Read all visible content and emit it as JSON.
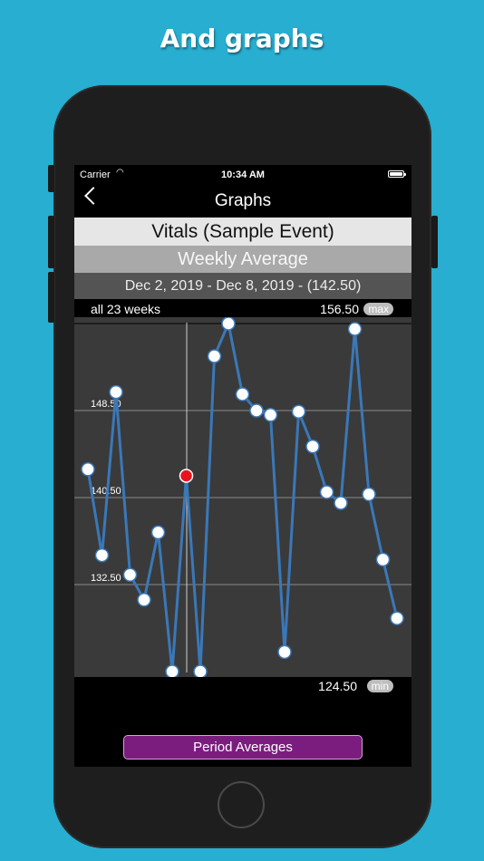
{
  "headline": "And graphs",
  "status_bar": {
    "carrier": "Carrier",
    "time": "10:34 AM"
  },
  "nav": {
    "title": "Graphs"
  },
  "event_title": "Vitals (Sample Event)",
  "mode_label": "Weekly Average",
  "selected_range": "Dec 2, 2019 - Dec 8, 2019 - (142.50)",
  "range_label": "all 23 weeks",
  "max_value": "156.50",
  "max_badge": "max",
  "min_value": "124.50",
  "min_badge": "min",
  "button_label": "Period Averages",
  "colors": {
    "line": "#3a78b8",
    "point": "#ffffff",
    "selected_point": "#e8141d",
    "button": "#7a1d7e",
    "plot_bg": "#3a3a3a"
  },
  "chart_data": {
    "type": "line",
    "ylim": [
      124.5,
      156.5
    ],
    "grid": true,
    "y_tick_labels": [
      "148.50",
      "140.50",
      "132.50"
    ],
    "x": [
      1,
      2,
      3,
      4,
      5,
      6,
      7,
      8,
      9,
      10,
      11,
      12,
      13,
      14,
      15,
      16,
      17,
      18,
      19,
      20,
      21,
      22,
      23
    ],
    "series": [
      {
        "values": [
          143.1,
          135.2,
          150.2,
          133.4,
          131.1,
          137.3,
          124.5,
          142.5,
          124.5,
          153.5,
          156.5,
          150.0,
          148.5,
          148.1,
          126.3,
          148.4,
          145.2,
          141.0,
          140.0,
          156.0,
          140.8,
          134.8,
          129.4
        ],
        "selected_index": 7
      }
    ]
  }
}
